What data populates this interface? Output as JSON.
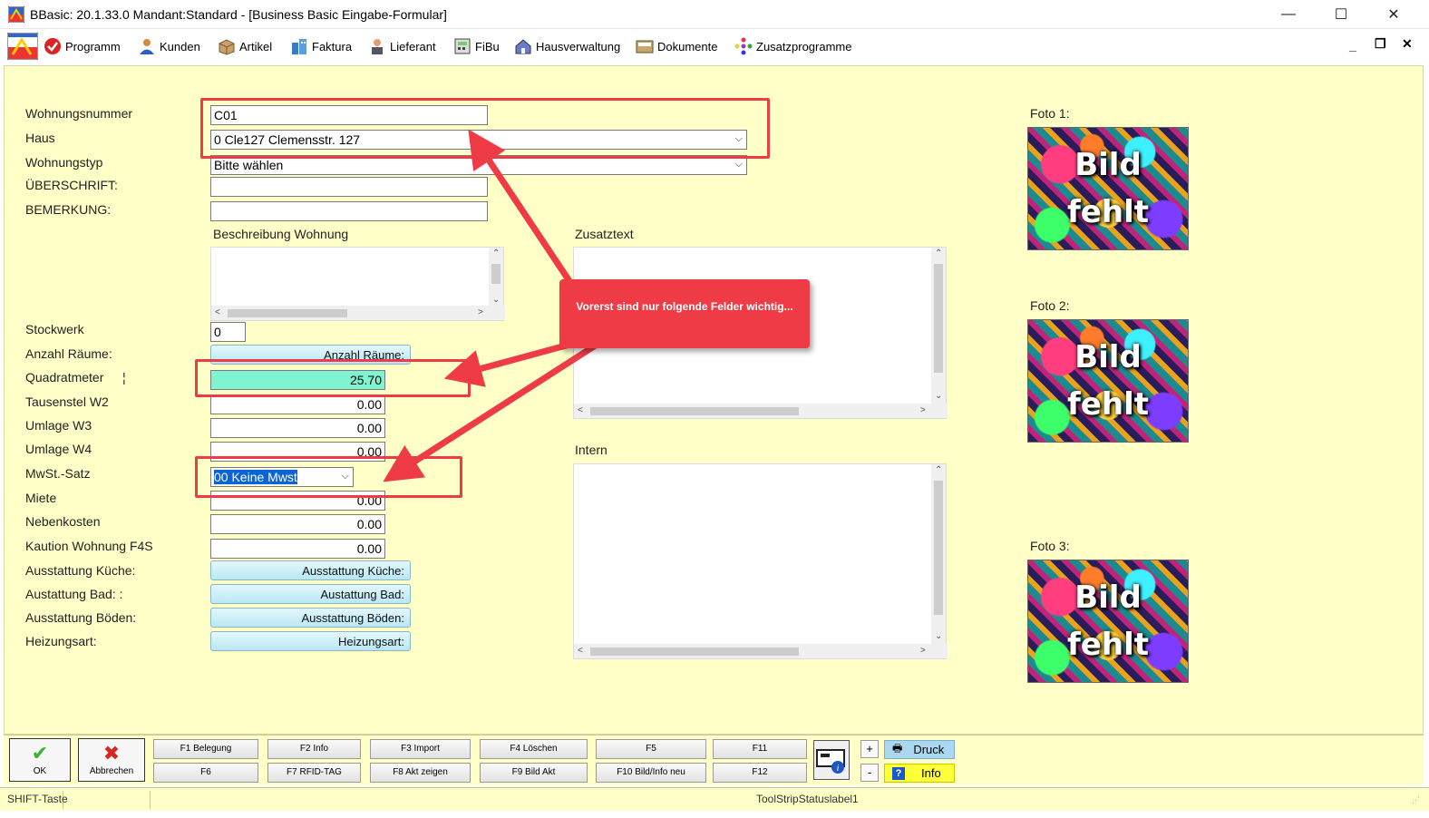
{
  "window": {
    "title": "BBasic: 20.1.33.0 Mandant:Standard  - [Business Basic Eingabe-Formular]",
    "minimize": "—",
    "maximize": "☐",
    "close": "✕"
  },
  "menu": {
    "items": [
      {
        "label": "Programm",
        "icon": "program-icon"
      },
      {
        "label": "Kunden",
        "icon": "customers-icon"
      },
      {
        "label": "Artikel",
        "icon": "articles-icon"
      },
      {
        "label": "Faktura",
        "icon": "invoice-icon"
      },
      {
        "label": "Lieferant",
        "icon": "supplier-icon"
      },
      {
        "label": "FiBu",
        "icon": "accounting-icon"
      },
      {
        "label": "Hausverwaltung",
        "icon": "house-management-icon"
      },
      {
        "label": "Dokumente",
        "icon": "documents-icon"
      },
      {
        "label": "Zusatzprogramme",
        "icon": "addon-programs-icon"
      }
    ],
    "mdi_minimize": "_",
    "mdi_restore": "❐",
    "mdi_close": "✕"
  },
  "form": {
    "labels": {
      "wohnungsnummer": "Wohnungsnummer",
      "haus": "Haus",
      "wohnungstyp": "Wohnungstyp",
      "ueberschrift": "ÜBERSCHRIFT:",
      "bemerkung": "BEMERKUNG:",
      "beschreibung": "Beschreibung Wohnung",
      "zusatztext": "Zusatztext",
      "intern": "Intern",
      "stockwerk": "Stockwerk",
      "anzahl_raeume": "Anzahl Räume:",
      "quadratmeter": "Quadratmeter",
      "quadratmeter_marker": "¦",
      "tausenstel": "Tausenstel W2",
      "umlage_w3": "Umlage W3",
      "umlage_w4": "Umlage W4",
      "mwst": "MwSt.-Satz",
      "miete": "Miete",
      "nebenkosten": "Nebenkosten",
      "kaution": "Kaution Wohnung F4S",
      "kueche": "Ausstattung Küche:",
      "bad": "Austattung Bad: :",
      "boeden": "Ausstattung Böden:",
      "heizung": "Heizungsart:",
      "foto1": "Foto 1:",
      "foto2": "Foto 2:",
      "foto3": "Foto 3:"
    },
    "values": {
      "wohnungsnummer": "C01",
      "haus": "0 Cle127 Clemensstr. 127",
      "wohnungstyp": "Bitte wählen",
      "ueberschrift": "",
      "bemerkung": "",
      "stockwerk": "0",
      "quadratmeter": "25.70",
      "tausenstel": "0.00",
      "umlage_w3": "0.00",
      "umlage_w4": "0.00",
      "mwst": "00 Keine Mwst",
      "miete": "0.00",
      "nebenkosten": "0.00",
      "kaution": "0.00"
    },
    "buttons": {
      "anzahl_raeume": "Anzahl Räume:",
      "kueche": "Ausstattung Küche:",
      "bad": "Austattung Bad:",
      "boeden": "Ausstattung Böden:",
      "heizung": "Heizungsart:"
    },
    "photo_placeholder": {
      "line1": "Bild",
      "line2": "fehlt"
    },
    "highlight_color": "#7ef5d0"
  },
  "annotation": {
    "callout_text": "Vorerst sind nur folgende Felder wichtig...",
    "color": "#ef3b46"
  },
  "toolbar": {
    "ok": "OK",
    "abbrechen": "Abbrechen",
    "fkeys_top": [
      "F1 Belegung",
      "F2 Info",
      "F3 Import",
      "F4 Löschen",
      "F5",
      "F11"
    ],
    "fkeys_bottom": [
      "F6",
      "F7 RFID-TAG",
      "F8 Akt zeigen",
      "F9 Bild Akt",
      "F10 Bild/Info neu",
      "F12"
    ],
    "plus": "+",
    "minus": "-",
    "druck": "Druck",
    "info": "Info"
  },
  "statusbar": {
    "shift": "SHIFT-Taste",
    "label": "ToolStripStatuslabel1"
  }
}
